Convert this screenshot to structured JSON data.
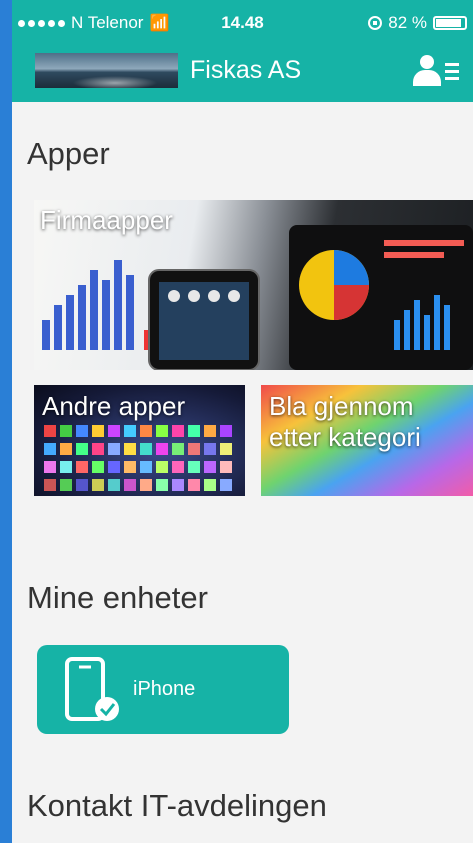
{
  "status_bar": {
    "carrier": "N Telenor",
    "time": "14.48",
    "battery": "82 %",
    "battery_level": 0.82,
    "signal_icon": "signal-dots-icon",
    "wifi_icon": "wifi-icon",
    "lock_icon": "orientation-lock-icon"
  },
  "header": {
    "company_name": "Fiskas AS",
    "logo_icon": "company-logo-image",
    "menu_icon": "user-menu-icon",
    "color": "#16b3a6"
  },
  "apps_section": {
    "title": "Apper",
    "tiles": [
      {
        "label": "Firmaapper"
      },
      {
        "label": "Andre apper"
      },
      {
        "label": "Bla gjennom etter kategori"
      }
    ]
  },
  "devices_section": {
    "title": "Mine enheter",
    "devices": [
      {
        "label": "iPhone",
        "icon": "phone-check-icon"
      }
    ]
  },
  "contact_section": {
    "title": "Kontakt IT-avdelingen"
  },
  "colors": {
    "accent": "#16b3a6",
    "background": "#f3f3f3",
    "text": "#333333"
  }
}
